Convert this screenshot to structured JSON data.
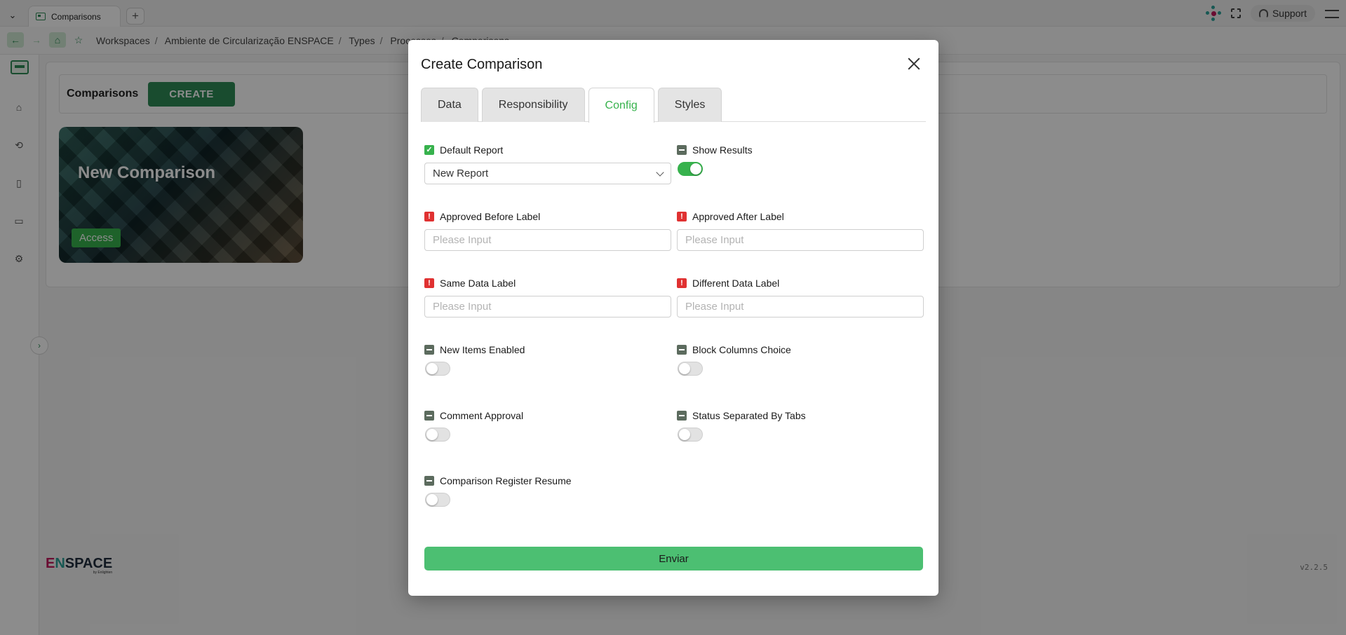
{
  "browser": {
    "tab_label": "Comparisons",
    "new_tab_symbol": "+",
    "support_label": "Support",
    "breadcrumb": [
      "Workspaces",
      "Ambiente de Circularização ENSPACE",
      "Types",
      "Processos",
      "Comparisons"
    ]
  },
  "page": {
    "header_title": "Comparisons",
    "create_label": "CREATE",
    "card": {
      "title": "New Comparison",
      "access_label": "Access"
    },
    "brand": {
      "e": "E",
      "n": "N",
      "rest": "SPACE",
      "sub": "by Enlighten"
    },
    "version": "v2.2.5"
  },
  "modal": {
    "title": "Create Comparison",
    "tabs": [
      {
        "label": "Data",
        "active": false
      },
      {
        "label": "Responsibility",
        "active": false
      },
      {
        "label": "Config",
        "active": true
      },
      {
        "label": "Styles",
        "active": false
      }
    ],
    "default_report": {
      "label": "Default Report",
      "value": "New Report"
    },
    "show_results": {
      "label": "Show Results",
      "on": true
    },
    "approved_before": {
      "label": "Approved Before Label",
      "placeholder": "Please Input"
    },
    "approved_after": {
      "label": "Approved After Label",
      "placeholder": "Please Input"
    },
    "same_data": {
      "label": "Same Data Label",
      "placeholder": "Please Input"
    },
    "different_data": {
      "label": "Different Data Label",
      "placeholder": "Please Input"
    },
    "new_items_enabled": {
      "label": "New Items Enabled",
      "on": false
    },
    "block_columns_choice": {
      "label": "Block Columns Choice",
      "on": false
    },
    "comment_approval": {
      "label": "Comment Approval",
      "on": false
    },
    "status_separated_by_tabs": {
      "label": "Status Separated By Tabs",
      "on": false
    },
    "comparison_register_resume": {
      "label": "Comparison Register Resume",
      "on": false
    },
    "submit_label": "Enviar"
  },
  "colors": {
    "accent": "#37b24d",
    "submit": "#4cbf72",
    "error": "#e03131"
  }
}
